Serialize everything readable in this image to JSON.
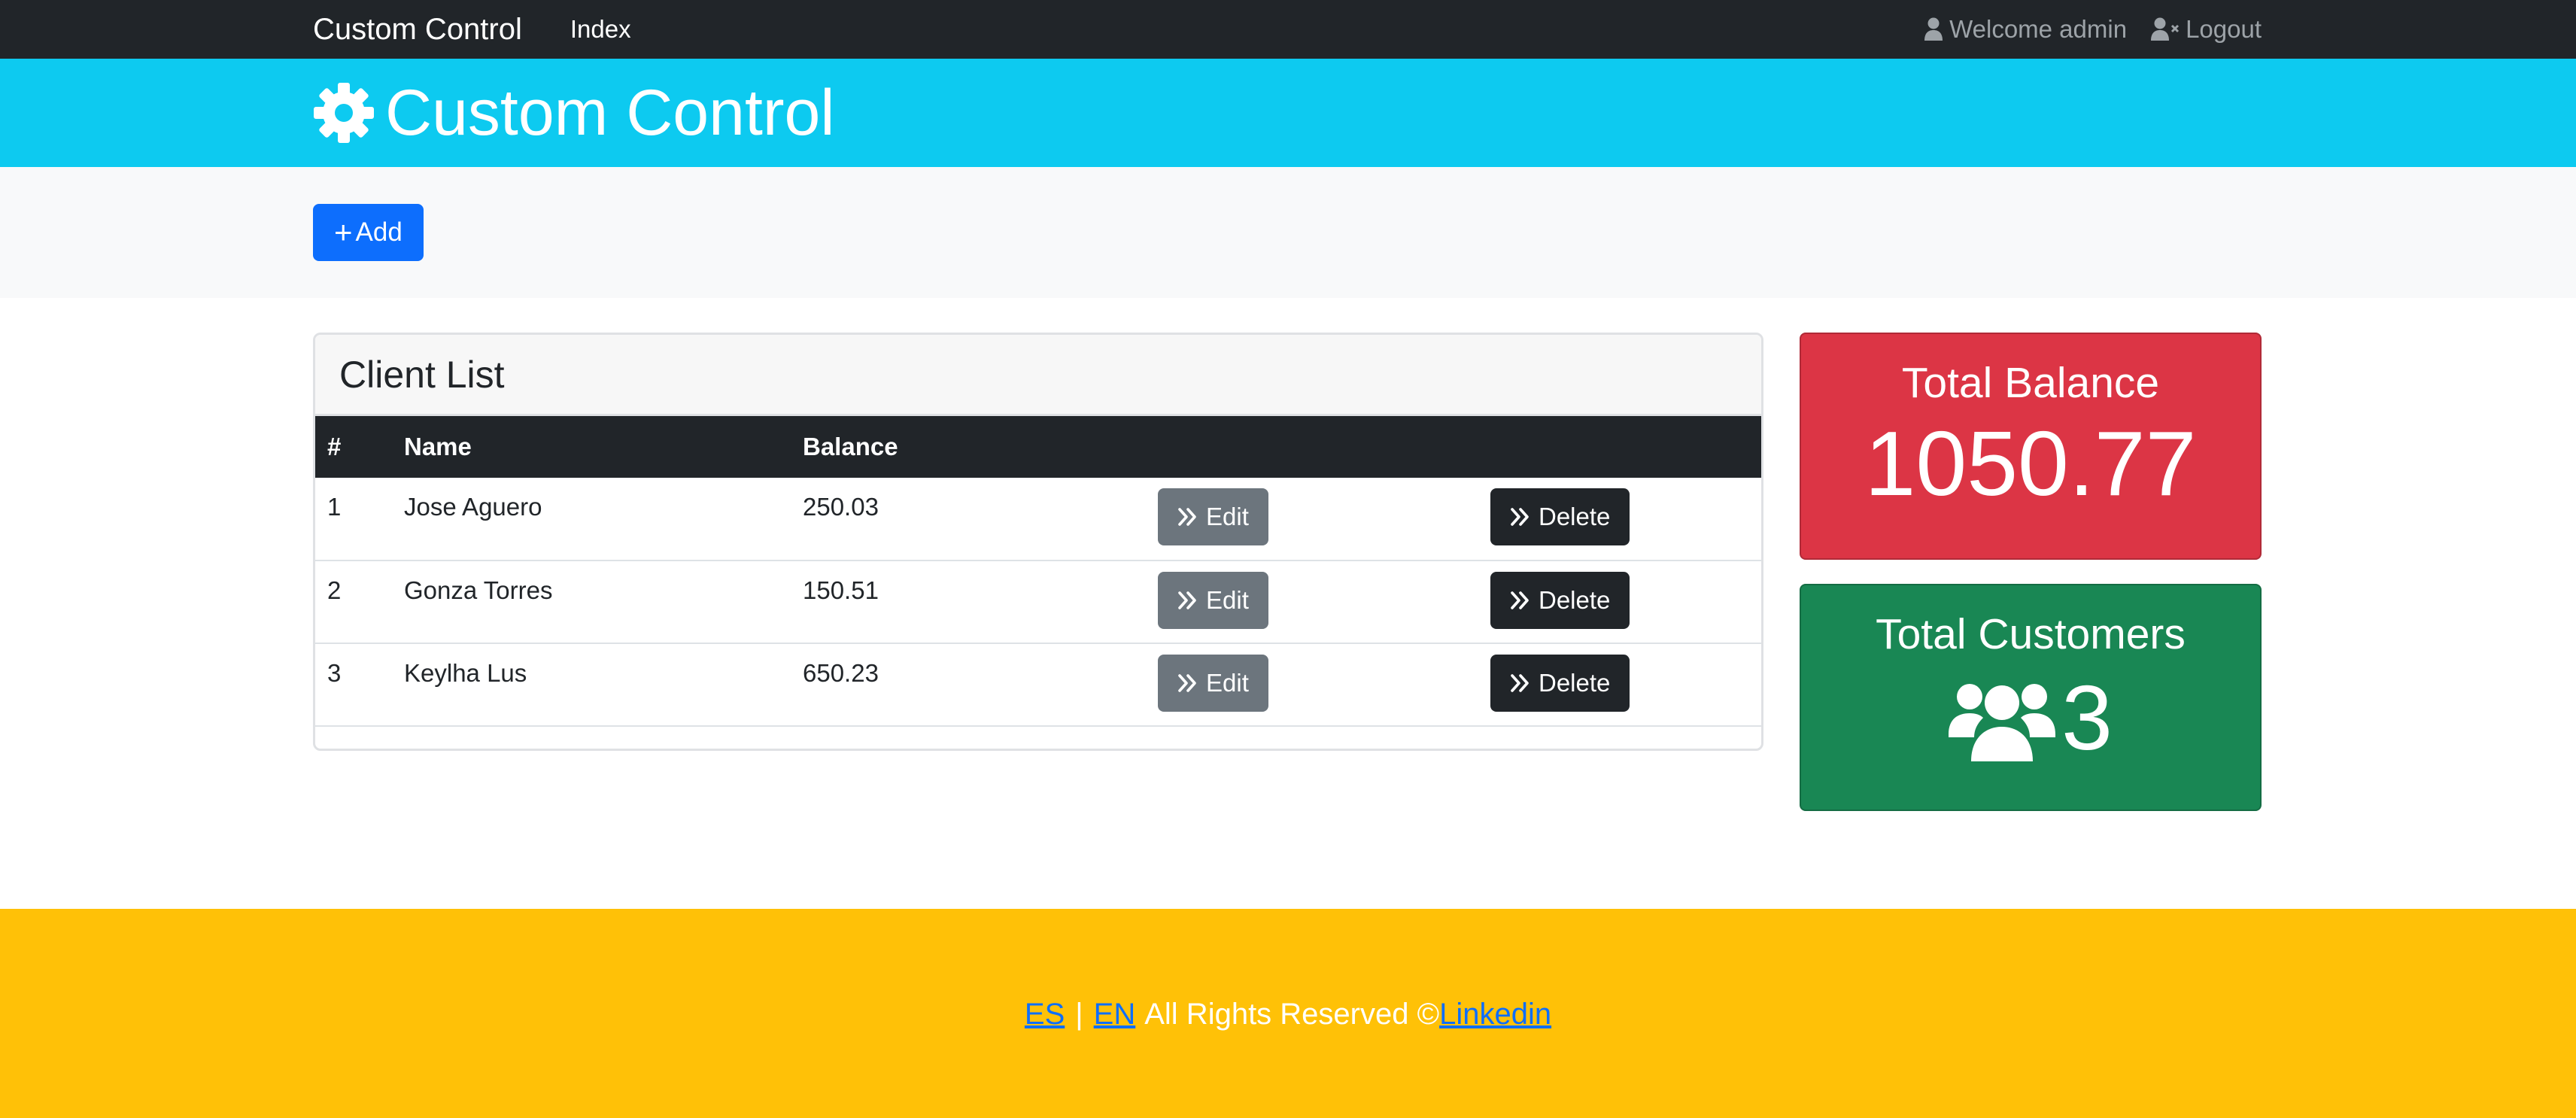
{
  "navbar": {
    "brand": "Custom Control",
    "link_index": "Index",
    "welcome": "Welcome admin",
    "logout": "Logout"
  },
  "header": {
    "title": "Custom Control",
    "icon": "gear-icon"
  },
  "actions": {
    "add_label": "Add"
  },
  "client_list": {
    "title": "Client List",
    "columns": [
      "#",
      "Name",
      "Balance",
      "",
      ""
    ],
    "rows": [
      {
        "num": "1",
        "name": "Jose Aguero",
        "balance": "250.03",
        "edit": "Edit",
        "delete": "Delete"
      },
      {
        "num": "2",
        "name": "Gonza Torres",
        "balance": "150.51",
        "edit": "Edit",
        "delete": "Delete"
      },
      {
        "num": "3",
        "name": "Keylha Lus",
        "balance": "650.23",
        "edit": "Edit",
        "delete": "Delete"
      }
    ]
  },
  "stats": {
    "balance_label": "Total Balance",
    "balance_value": "1050.77",
    "customers_label": "Total Customers",
    "customers_value": "3"
  },
  "footer": {
    "lang_es": "ES",
    "separator": "|",
    "lang_en": "EN",
    "rights": "All Rights Reserved ©",
    "linkedin": "Linkedin"
  },
  "colors": {
    "navbar": "#212529",
    "header": "#0dcaf0",
    "primary": "#0d6efd",
    "danger": "#dc3545",
    "success": "#198754",
    "warning": "#ffc107",
    "secondary": "#6c757d"
  }
}
